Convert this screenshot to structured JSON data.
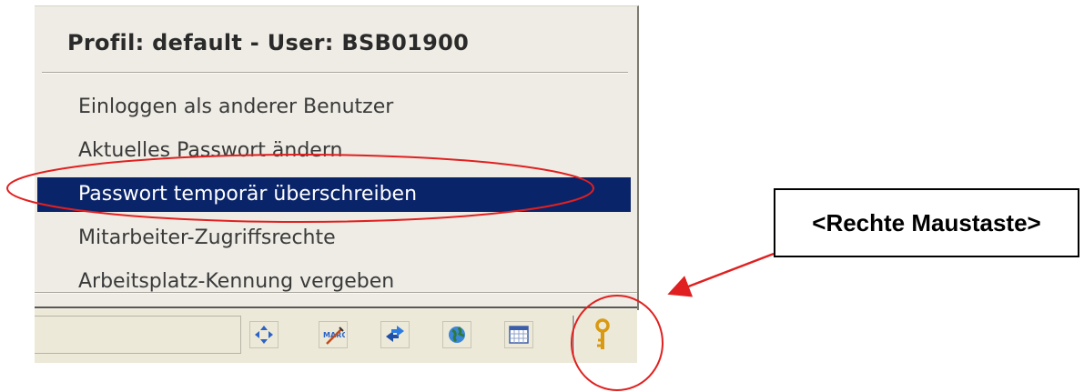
{
  "menu": {
    "header": "Profil: default - User:  BSB01900",
    "items": [
      {
        "label": "Einloggen als anderer Benutzer"
      },
      {
        "label": "Aktuelles Passwort ändern"
      },
      {
        "label": "Passwort temporär überschreiben",
        "selected": true
      },
      {
        "label": "Mitarbeiter-Zugriffsrechte"
      },
      {
        "label": "Arbeitsplatz-Kennung vergeben"
      }
    ],
    "selection_color": "#0a246a"
  },
  "statusbar": {
    "icons": [
      "move-arrows-icon",
      "marc-edit-icon",
      "swap-arrows-icon",
      "globe-icon",
      "calendar-grid-icon",
      "key-icon"
    ]
  },
  "annotation": {
    "callout_text": "<Rechte Maustaste>",
    "annotation_color": "#e02020"
  }
}
